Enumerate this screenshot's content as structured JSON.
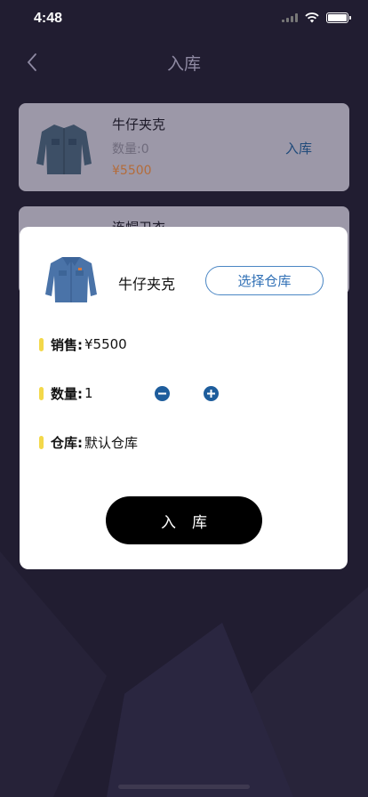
{
  "status_bar": {
    "time": "4:48"
  },
  "nav": {
    "title": "入库"
  },
  "list": [
    {
      "name": "牛仔夹克",
      "qty": "数量:0",
      "price": "¥5500",
      "action": "入库"
    },
    {
      "name": "连帽卫衣"
    }
  ],
  "modal": {
    "product_name": "牛仔夹克",
    "select_warehouse": "选择仓库",
    "sale_label": "销售:",
    "sale_value": "¥5500",
    "qty_label": "数量:",
    "qty_value": "1",
    "warehouse_label": "仓库:",
    "warehouse_value": "默认仓库",
    "confirm": "入库"
  },
  "colors": {
    "background": "#211d31",
    "accent_blue": "#2f6fb5",
    "price_orange": "#b46c3a",
    "marker_yellow": "#f3d84a"
  },
  "icons": [
    "back-chevron-icon",
    "wifi-icon",
    "signal-icon",
    "battery-icon",
    "minus-icon",
    "plus-icon",
    "jacket-image"
  ]
}
